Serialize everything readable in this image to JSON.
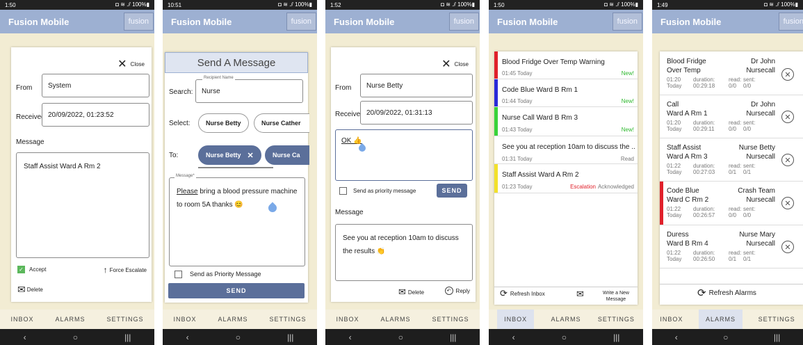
{
  "app": {
    "title": "Fusion Mobile",
    "logo": "fusion",
    "tabs": [
      "INBOX",
      "ALARMS",
      "SETTINGS"
    ],
    "nav": [
      "‹",
      "○",
      "|||"
    ]
  },
  "p1": {
    "time": "1:50",
    "status_right": "◘ ≋ .⫽ 100%▮",
    "close": "Close",
    "from_label": "From",
    "from_value": "System",
    "received_label": "Received",
    "received_value": "20/09/2022, 01:23:52",
    "message_label": "Message",
    "message": "Staff Assist Ward A Rm 2",
    "accept": "Accept",
    "force": "Force Escalate",
    "delete": "Delete"
  },
  "p2": {
    "time": "10:51",
    "status_right": "◘ ≋ .⫽ 100%▮",
    "header": "Send A Message",
    "search_label": "Search:",
    "recipient_label": "Recipient Name",
    "recipient_value": "Nurse",
    "select_label": "Select:",
    "chip1": "Nurse Betty",
    "chip2": "Nurse Cather",
    "to_label": "To:",
    "to1": "Nurse Betty",
    "to2": "Nurse Ca",
    "message_legend": "Message*",
    "message_u": "Please",
    "message_rest": " bring a blood pressure machine to room 5A thanks 😊",
    "priority": "Send as Priority Message",
    "send": "SEND"
  },
  "p3": {
    "time": "1:52",
    "status_right": "◘ ≋ .⫽ 100%▮",
    "close": "Close",
    "from_label": "From",
    "from_value": "Nurse Betty",
    "received_label": "Received",
    "received_value": "20/09/2022, 01:31:13",
    "reply_text": "OK 👍",
    "priority": "Send as priority message",
    "send": "SEND",
    "message_label": "Message",
    "message": "See you at reception 10am to discuss the results 👏",
    "delete": "Delete",
    "reply": "Reply"
  },
  "p4": {
    "time": "1:50",
    "status_right": "◘ ≋ .⫽ 100%▮",
    "items": [
      {
        "title": "Blood Fridge Over Temp Warning",
        "time": "01:45 Today",
        "status": "New!",
        "color": "#e0202a"
      },
      {
        "title": "Code Blue Ward B Rm 1",
        "time": "01:44 Today",
        "status": "New!",
        "color": "#2a2ad8"
      },
      {
        "title": "Nurse Call Ward B Rm 3",
        "time": "01:43 Today",
        "status": "New!",
        "color": "#39d339"
      },
      {
        "title": "See you at reception 10am to discuss the ...",
        "time": "01:31 Today",
        "status": "Read",
        "color": ""
      },
      {
        "title": "Staff Assist Ward A Rm 2",
        "time": "01:23 Today",
        "status": "Escalation",
        "status2": "Acknowledged",
        "color": "#f2e12a"
      }
    ],
    "refresh": "Refresh Inbox",
    "write1": "Write a New",
    "write2": "Message"
  },
  "p5": {
    "time": "1:49",
    "status_right": "◘ ≋ .⫽ 100%▮",
    "alarms": [
      {
        "l1": "Blood Fridge",
        "l2": "Over Temp",
        "r1": "Dr John",
        "r2": "Nursecall",
        "t": "01:20",
        "d": "Today",
        "dur": "00:29:18",
        "read": "0/0",
        "sent": "0/0",
        "color": ""
      },
      {
        "l1": "Call",
        "l2": "Ward A Rm 1",
        "r1": "Dr John",
        "r2": "Nursecall",
        "t": "01:20",
        "d": "Today",
        "dur": "00:29:11",
        "read": "0/0",
        "sent": "0/0",
        "color": ""
      },
      {
        "l1": "Staff Assist",
        "l2": "Ward A Rm 3",
        "r1": "Nurse Betty",
        "r2": "Nursecall",
        "t": "01:22",
        "d": "Today",
        "dur": "00:27:03",
        "read": "0/1",
        "sent": "0/1",
        "color": ""
      },
      {
        "l1": "Code Blue",
        "l2": "Ward C Rm 2",
        "r1": "Crash Team",
        "r2": "Nursecall",
        "t": "01:22",
        "d": "Today",
        "dur": "00:26:57",
        "read": "0/0",
        "sent": "0/0",
        "color": "#e0202a"
      },
      {
        "l1": "Duress",
        "l2": "Ward B Rm 4",
        "r1": "Nurse Mary",
        "r2": "Nursecall",
        "t": "01:22",
        "d": "Today",
        "dur": "00:26:50",
        "read": "0/1",
        "sent": "0/1",
        "color": ""
      }
    ],
    "duration_label": "duration:",
    "read_label": "read:",
    "sent_label": "sent:",
    "refresh": "Refresh Alarms"
  }
}
